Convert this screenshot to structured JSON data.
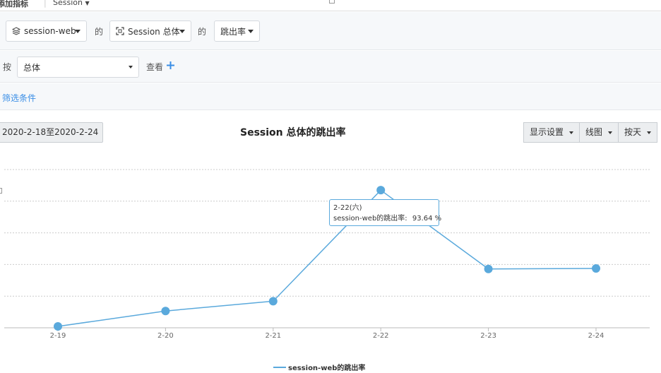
{
  "topbar": {
    "title": "添加指标",
    "session_label": "Session"
  },
  "metric_row": {
    "source_select": "session-web",
    "de1": "的",
    "target_select": "Session 总体",
    "de2": "的",
    "metric_select": "跳出率"
  },
  "group_row": {
    "by_label": "按",
    "group_select": "总体",
    "view_label": "查看",
    "add_icon": "plus-icon"
  },
  "filter_row": {
    "filter_link": "筛选条件"
  },
  "toolbar": {
    "date_range": "2020-2-18至2020-2-24",
    "chart_title": "Session 总体的跳出率",
    "display_settings": "显示设置",
    "chart_type": "线图",
    "granularity": "按天"
  },
  "tooltip": {
    "date": "2-22(六)",
    "series_label": "session-web的跳出率:",
    "value": "93.64 %"
  },
  "chart_data": {
    "type": "line",
    "x": [
      "2-19",
      "2-20",
      "2-21",
      "2-22",
      "2-23",
      "2-24"
    ],
    "series": [
      {
        "name": "session-web的跳出率",
        "values": [
          45.0,
          50.5,
          54.0,
          93.64,
          65.5,
          65.7
        ]
      }
    ],
    "ylim": [
      44.5,
      101
    ],
    "grid": true,
    "legend_position": "bottom-center",
    "color": "#5aa9dc"
  }
}
